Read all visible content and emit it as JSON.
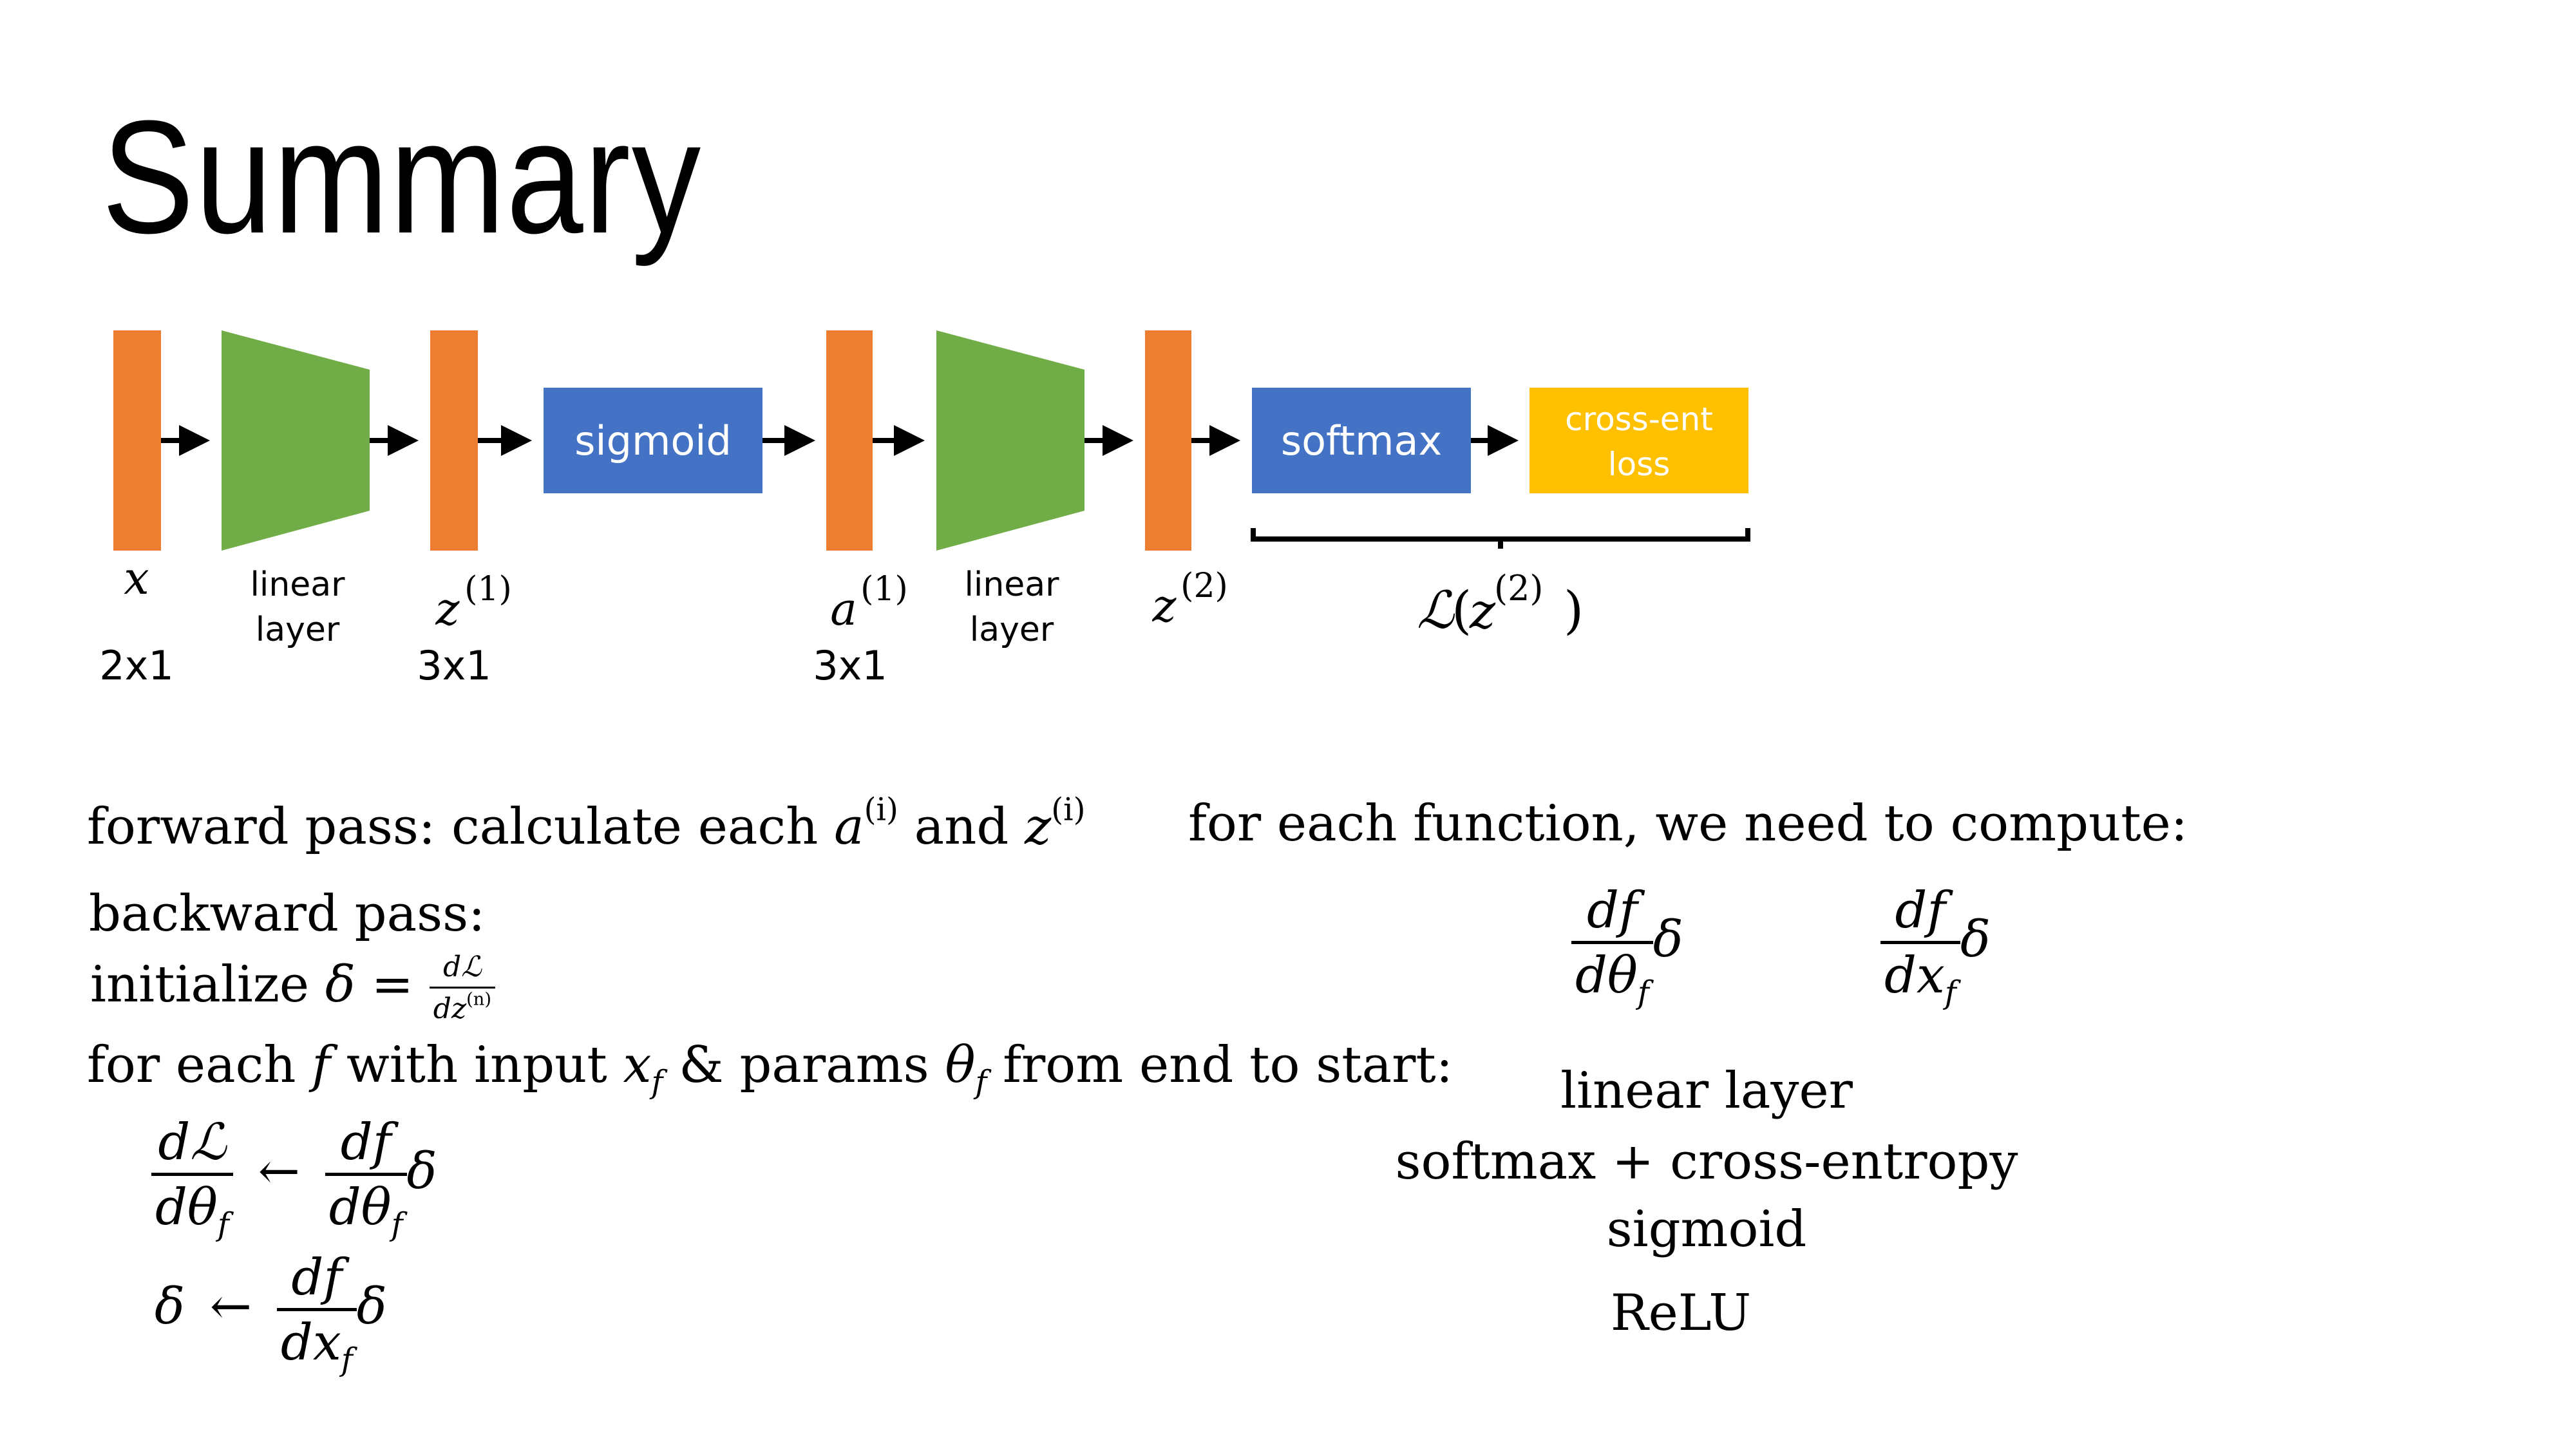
{
  "title": "Summary",
  "diagram": {
    "colors": {
      "vector": "#ED7D31",
      "linear_layer": "#70AD47",
      "activation_box": "#4472C4",
      "loss_box": "#FFC000",
      "arrow": "#000000"
    },
    "nodes": [
      {
        "id": "x",
        "type": "vector",
        "math_label": "x",
        "dim": "2x1"
      },
      {
        "id": "linear1",
        "type": "linear_layer",
        "label_line1": "linear",
        "label_line2": "layer"
      },
      {
        "id": "z1",
        "type": "vector",
        "math_label": "z",
        "superscript": "(1)",
        "dim": "3x1"
      },
      {
        "id": "sigmoid",
        "type": "activation_box",
        "label": "sigmoid"
      },
      {
        "id": "a1",
        "type": "vector",
        "math_label": "a",
        "superscript": "(1)",
        "dim": "3x1"
      },
      {
        "id": "linear2",
        "type": "linear_layer",
        "label_line1": "linear",
        "label_line2": "layer"
      },
      {
        "id": "z2",
        "type": "vector",
        "math_label": "z",
        "superscript": "(2)"
      },
      {
        "id": "softmax",
        "type": "activation_box",
        "label": "softmax"
      },
      {
        "id": "loss",
        "type": "loss_box",
        "label_line1": "cross-ent",
        "label_line2": "loss"
      }
    ],
    "brace_label": {
      "fn": "ℒ",
      "arg": "z",
      "superscript": "(2)"
    }
  },
  "left_text": {
    "forward": {
      "prefix": "forward pass: calculate each ",
      "a": "a",
      "sup_i": "(i)",
      "and": " and ",
      "z": "z"
    },
    "backward_heading": "backward pass:",
    "initialize": {
      "prefix": "initialize ",
      "delta": "δ",
      "eq": " = ",
      "num": "dℒ",
      "den": "dz",
      "den_sup": "(n)"
    },
    "loop": {
      "part1": "for each ",
      "f": "f",
      "part2": " with input ",
      "x": "x",
      "sub_f": "f",
      "part3": " & params ",
      "theta": "θ",
      "part4": " from end to start:"
    },
    "update1": {
      "lhs_num": "dℒ",
      "lhs_den": "dθ",
      "sub": "f",
      "arrow": "←",
      "rhs_num": "df",
      "rhs_den": "dθ",
      "delta": "δ"
    },
    "update2": {
      "lhs": "δ",
      "arrow": "←",
      "rhs_num": "df",
      "rhs_den": "dx",
      "sub": "f",
      "delta": "δ"
    }
  },
  "right_text": {
    "heading": "for each function, we need to compute:",
    "deriv1": {
      "num": "df",
      "den": "dθ",
      "sub": "f",
      "delta": "δ"
    },
    "deriv2": {
      "num": "df",
      "den": "dx",
      "sub": "f",
      "delta": "δ"
    },
    "functions": [
      "linear layer",
      "softmax + cross-entropy",
      "sigmoid",
      "ReLU"
    ]
  }
}
